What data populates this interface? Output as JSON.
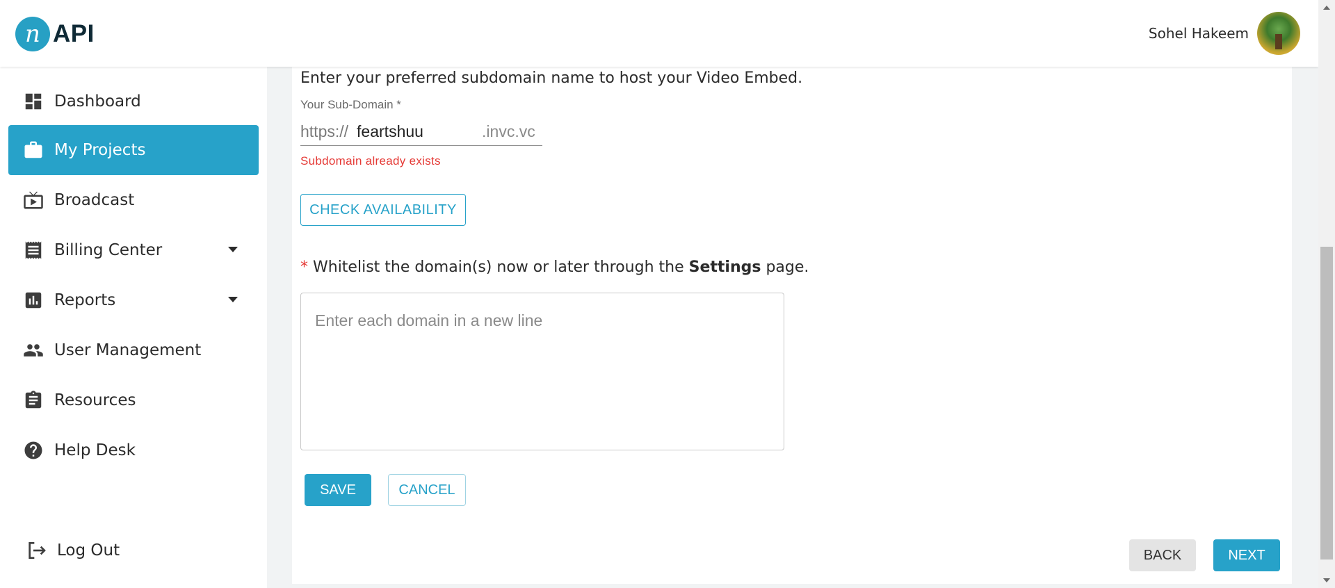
{
  "header": {
    "logo_mark": "n",
    "logo_text": "API",
    "user_name": "Sohel Hakeem"
  },
  "sidebar": {
    "items": [
      {
        "label": "Dashboard",
        "icon": "dashboard-icon",
        "active": false
      },
      {
        "label": "My Projects",
        "icon": "briefcase-icon",
        "active": true
      },
      {
        "label": "Broadcast",
        "icon": "tv-icon",
        "active": false
      },
      {
        "label": "Billing Center",
        "icon": "receipt-icon",
        "active": false,
        "expandable": true
      },
      {
        "label": "Reports",
        "icon": "bar-chart-icon",
        "active": false,
        "expandable": true
      },
      {
        "label": "User Management",
        "icon": "people-icon",
        "active": false
      },
      {
        "label": "Resources",
        "icon": "clipboard-icon",
        "active": false
      },
      {
        "label": "Help Desk",
        "icon": "help-icon",
        "active": false
      }
    ],
    "logout_label": "Log Out"
  },
  "form": {
    "intro": "Enter your preferred subdomain name to host your Video Embed.",
    "subdomain_label": "Your Sub-Domain *",
    "prefix": "https://",
    "subdomain_value": "feartshuu",
    "suffix": ".invc.vc",
    "error": "Subdomain already exists",
    "check_label": "CHECK AVAILABILITY",
    "whitelist_star": "*",
    "whitelist_before": "Whitelist the domain(s) now or later through the",
    "whitelist_bold": "Settings",
    "whitelist_after": "page.",
    "domains_placeholder": "Enter each domain in a new line",
    "save_label": "SAVE",
    "cancel_label": "CANCEL",
    "back_label": "BACK",
    "next_label": "NEXT"
  },
  "colors": {
    "accent": "#27a2c9",
    "error": "#e53935"
  }
}
